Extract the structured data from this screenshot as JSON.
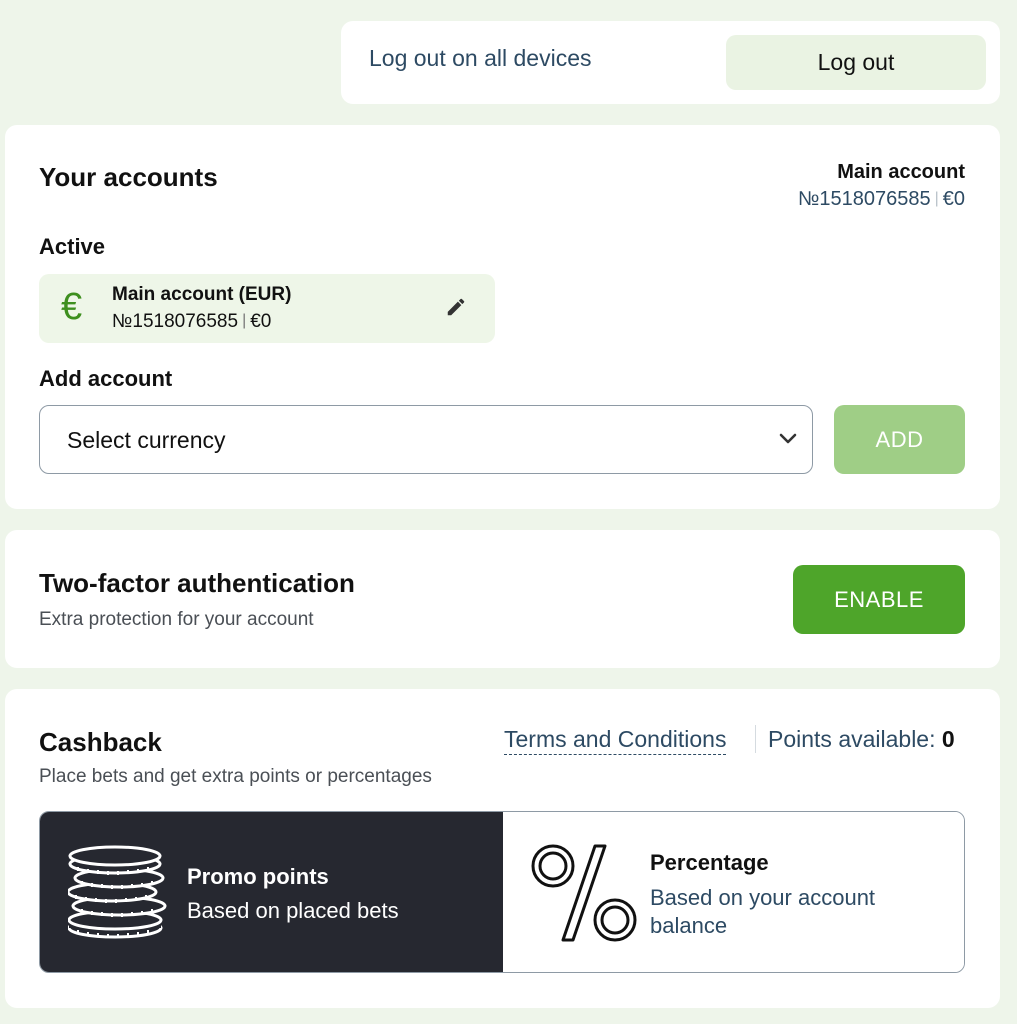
{
  "logout": {
    "all_devices_label": "Log out on all devices",
    "logout_label": "Log out"
  },
  "accounts": {
    "title": "Your accounts",
    "main_account_label": "Main account",
    "main_account_number": "№1518076585",
    "main_account_balance": "€0",
    "active_label": "Active",
    "active_account": {
      "currency_symbol": "€",
      "name": "Main account (EUR)",
      "number": "№1518076585",
      "balance": "€0"
    },
    "add_label": "Add account",
    "select_placeholder": "Select currency",
    "add_button": "ADD"
  },
  "two_factor": {
    "title": "Two-factor authentication",
    "subtitle": "Extra protection for your account",
    "enable_button": "ENABLE"
  },
  "cashback": {
    "title": "Cashback",
    "subtitle": "Place bets and get extra points or percentages",
    "terms_link": "Terms and Conditions",
    "points_label": "Points available:",
    "points_value": "0",
    "options": {
      "promo": {
        "title": "Promo points",
        "subtitle": "Based on placed bets",
        "selected": true
      },
      "percentage": {
        "title": "Percentage",
        "subtitle": "Based on your account balance",
        "selected": false
      }
    }
  },
  "colors": {
    "background": "#eef5ea",
    "accent_green": "#4ea52a",
    "disabled_green": "#9fce86",
    "dark_tile": "#262830",
    "link_blue": "#2d4a63"
  },
  "icons": {
    "euro": "euro-icon",
    "edit": "pencil-icon",
    "dropdown": "chevron-down-icon",
    "promo": "coins-stack-icon",
    "percentage": "percent-icon"
  }
}
